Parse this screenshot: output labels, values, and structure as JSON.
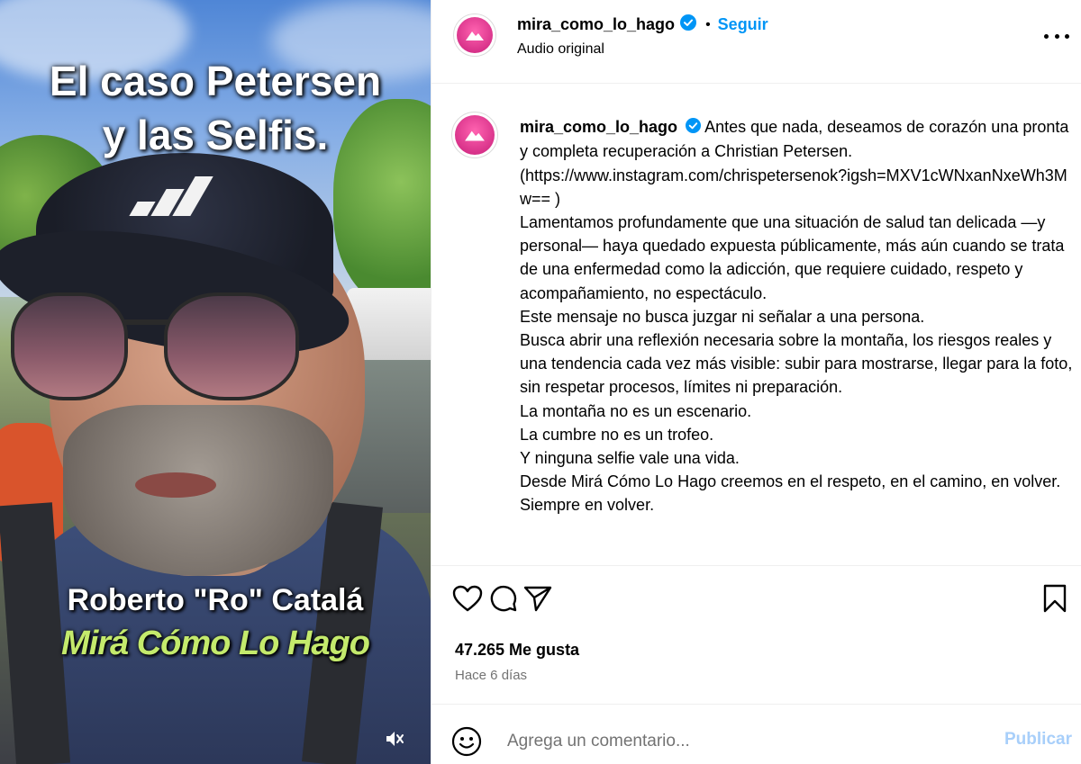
{
  "media": {
    "title_line1": "El caso Petersen",
    "title_line2": "y las Selfis.",
    "name_line": "Roberto \"Ro\" Catalá",
    "brand_line": "Mirá Cómo Lo Hago",
    "mute_icon": "speaker-muted-icon"
  },
  "header": {
    "username": "mira_como_lo_hago",
    "verified": true,
    "separator": "•",
    "follow_label": "Seguir",
    "audio_label": "Audio original",
    "more_icon": "more-options-icon"
  },
  "caption": {
    "username": "mira_como_lo_hago",
    "first_line": "Antes que nada, deseamos de corazón una pronta y completa recuperación a Christian Petersen.",
    "link_line": "(https://www.instagram.com/chrispetersenok?igsh=MXV1cWNxanNxeWh3Mw== )",
    "paragraphs": [
      "Lamentamos profundamente que una situación de salud tan delicada —y personal— haya quedado expuesta públicamente, más aún cuando se trata de una enfermedad como la adicción, que requiere cuidado, respeto y acompañamiento, no espectáculo.",
      "Este mensaje no busca juzgar ni señalar a una persona.",
      "Busca abrir una reflexión necesaria sobre la montaña, los riesgos reales y una tendencia cada vez más visible: subir para mostrarse, llegar para la foto, sin respetar procesos, límites ni preparación.",
      "La montaña no es un escenario.",
      "La cumbre no es un trofeo.",
      "Y ninguna selfie vale una vida.",
      "Desde Mirá Cómo Lo Hago creemos en el respeto, en el camino, en volver.",
      "Siempre en volver."
    ]
  },
  "actions": {
    "icons": [
      "heart-icon",
      "comment-icon",
      "share-icon",
      "bookmark-icon"
    ]
  },
  "stats": {
    "likes": "47.265 Me gusta",
    "time_ago": "Hace 6 días"
  },
  "comment": {
    "placeholder": "Agrega un comentario...",
    "publish_label": "Publicar",
    "emoji_icon": "emoji-icon"
  },
  "colors": {
    "accent": "#0095f6",
    "publish_disabled": "#a8cffa",
    "secondary_text": "#737373",
    "brand_green": "#c4ea6c"
  }
}
